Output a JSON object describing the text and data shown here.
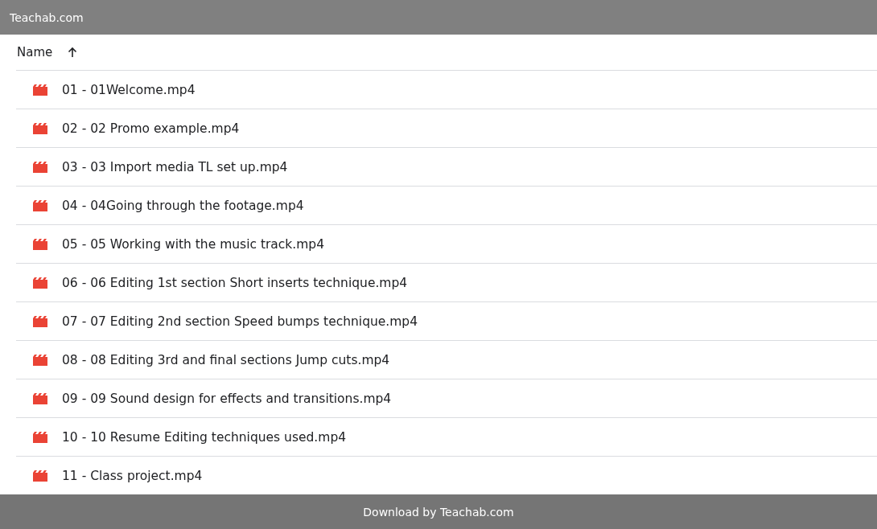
{
  "header": {
    "title": "Teachab.com"
  },
  "table": {
    "columns": [
      {
        "label": "Name",
        "sort_ascending": true
      }
    ],
    "rows": [
      {
        "name": "01 - 01Welcome.mp4"
      },
      {
        "name": "02 - 02 Promo example.mp4"
      },
      {
        "name": "03 - 03 Import media TL set up.mp4"
      },
      {
        "name": "04 - 04Going through the footage.mp4"
      },
      {
        "name": "05 - 05 Working with the music track.mp4"
      },
      {
        "name": "06 - 06 Editing 1st section Short inserts technique.mp4"
      },
      {
        "name": "07 - 07 Editing 2nd section Speed bumps technique.mp4"
      },
      {
        "name": "08 - 08 Editing 3rd and final sections Jump cuts.mp4"
      },
      {
        "name": "09 - 09 Sound design for effects and transitions.mp4"
      },
      {
        "name": "10 - 10 Resume Editing techniques used.mp4"
      },
      {
        "name": "11 - Class project.mp4"
      }
    ]
  },
  "footer": {
    "text": "Download by Teachab.com"
  }
}
